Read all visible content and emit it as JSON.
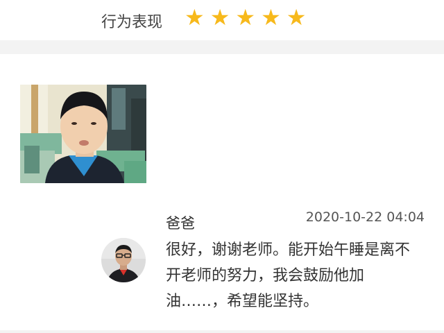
{
  "rating": {
    "label": "行为表现",
    "stars": 5,
    "max_stars": 5,
    "star_glyph": "★",
    "star_color": "#f7b91c"
  },
  "post": {
    "photo_alt": "student photo"
  },
  "reply": {
    "author": "爸爸",
    "timestamp": "2020-10-22 04:04",
    "text": "很好，谢谢老师。能开始午睡是离不开老师的努力，我会鼓励他加油……，希望能坚持。"
  },
  "colors": {
    "separator": "#f3f3f3",
    "text": "#333333"
  }
}
